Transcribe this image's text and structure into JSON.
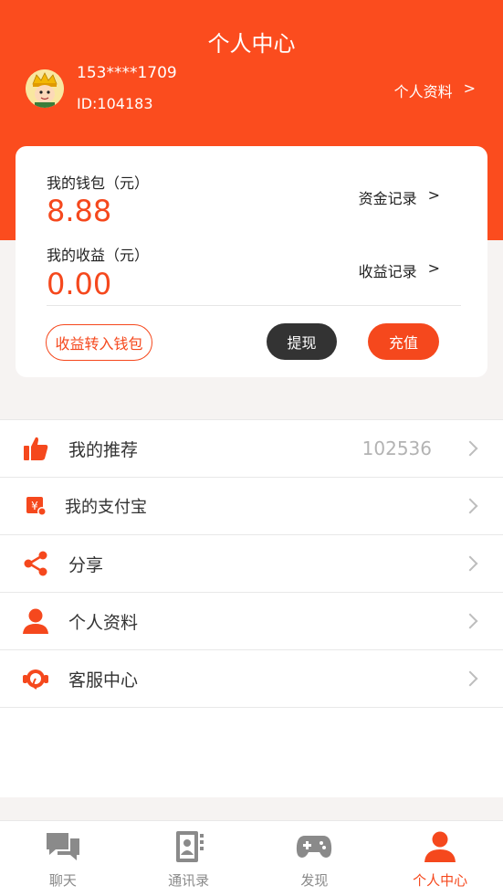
{
  "header": {
    "title": "个人中心",
    "phone": "153****1709",
    "user_id": "ID:104183",
    "profile_link": "个人资料",
    "profile_arrow": ">"
  },
  "wallet": {
    "wallet_label": "我的钱包（元）",
    "wallet_value": "8.88",
    "wallet_link": "资金记录",
    "earnings_label": "我的收益（元）",
    "earnings_value": "0.00",
    "earnings_link": "收益记录",
    "arrow": ">",
    "transfer_button": "收益转入钱包",
    "withdraw_button": "提现",
    "recharge_button": "充值"
  },
  "menu": {
    "items": [
      {
        "label": "我的推荐",
        "value": "102536",
        "icon": "thumbs-up-icon"
      },
      {
        "label": "我的支付宝",
        "value": "",
        "icon": "alipay-icon"
      },
      {
        "label": "分享",
        "value": "",
        "icon": "share-icon"
      },
      {
        "label": "个人资料",
        "value": "",
        "icon": "person-icon"
      },
      {
        "label": "客服中心",
        "value": "",
        "icon": "headset-icon"
      }
    ]
  },
  "tabbar": {
    "tabs": [
      {
        "label": "聊天",
        "icon": "chat-icon",
        "active": false
      },
      {
        "label": "通讯录",
        "icon": "contacts-icon",
        "active": false
      },
      {
        "label": "发现",
        "icon": "gamepad-icon",
        "active": false
      },
      {
        "label": "个人中心",
        "icon": "person-icon",
        "active": true
      }
    ]
  },
  "colors": {
    "accent": "#fb4c1e",
    "dark_button": "#333333",
    "inactive_tab": "#8a8a8a"
  }
}
